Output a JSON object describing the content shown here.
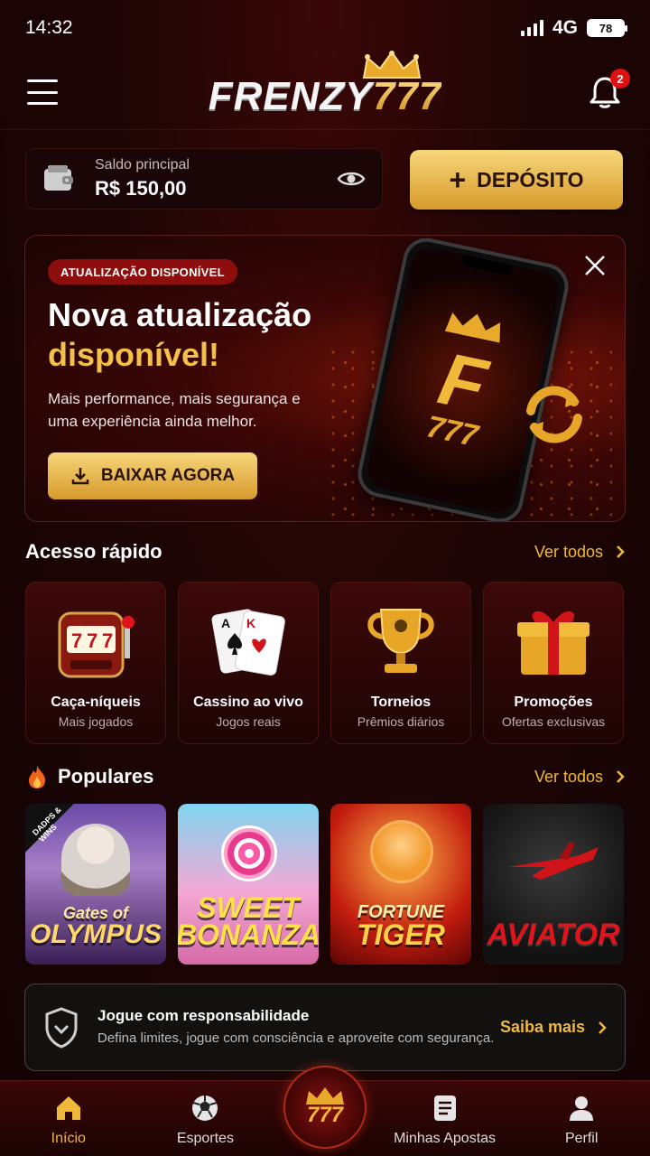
{
  "status_bar": {
    "time": "14:32",
    "network": "4G",
    "battery": "78"
  },
  "header": {
    "logo_word": "FRENZY",
    "logo_number": "777",
    "notification_count": "2"
  },
  "balance": {
    "label": "Saldo principal",
    "value": "R$ 150,00",
    "deposit_label": "DEPÓSITO"
  },
  "update_banner": {
    "tag": "ATUALIZAÇÃO DISPONÍVEL",
    "title_line1": "Nova atualização",
    "title_line2": "disponível!",
    "description": "Mais performance, mais segurança e uma experiência ainda melhor.",
    "button_label": "BAIXAR AGORA",
    "phone_logo_letter": "F",
    "phone_logo_number": "777"
  },
  "quick_access": {
    "title": "Acesso rápido",
    "see_all": "Ver todos",
    "items": [
      {
        "name": "Caça-níqueis",
        "sub": "Mais jogados",
        "icon": "slot-machine-icon"
      },
      {
        "name": "Cassino ao vivo",
        "sub": "Jogos reais",
        "icon": "playing-cards-icon"
      },
      {
        "name": "Torneios",
        "sub": "Prêmios diários",
        "icon": "trophy-icon"
      },
      {
        "name": "Promoções",
        "sub": "Ofertas exclusivas",
        "icon": "gift-icon"
      }
    ]
  },
  "popular": {
    "title": "Populares",
    "see_all": "Ver todos",
    "games": [
      {
        "line1": "Gates of",
        "line2": "OLYMPUS",
        "badge": "DADPS & WINS"
      },
      {
        "line1": "SWEET",
        "line2": "BONANZA"
      },
      {
        "line1": "FORTUNE",
        "line2": "TIGER"
      },
      {
        "line1": "AVIATOR"
      }
    ]
  },
  "responsible": {
    "title": "Jogue com responsabilidade",
    "description": "Defina limites, jogue com consciência e aproveite com segurança.",
    "link": "Saiba mais"
  },
  "bottom_nav": {
    "items": [
      {
        "label": "Início",
        "active": true
      },
      {
        "label": "Esportes"
      },
      {
        "label": "Minhas Apostas"
      },
      {
        "label": "Perfil"
      }
    ],
    "center_label": "777"
  },
  "colors": {
    "accent_gold": "#f0b93a",
    "background": "#1e0505",
    "tag_red": "#8e0d0d"
  }
}
